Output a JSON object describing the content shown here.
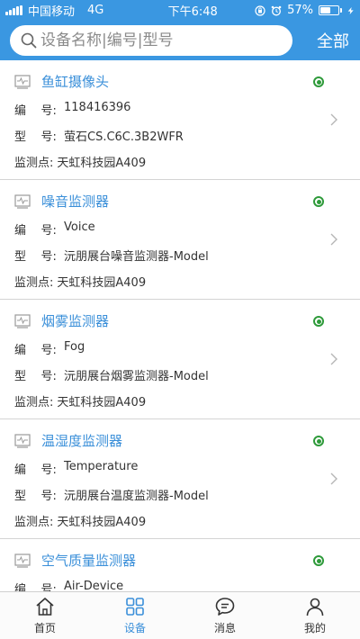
{
  "status_bar": {
    "carrier": "中国移动",
    "network": "4G",
    "time": "下午6:48",
    "battery": "57%",
    "battery_level": 0.57
  },
  "search": {
    "placeholder": "设备名称|编号|型号",
    "value": "",
    "filter_label": "全部"
  },
  "devices": [
    {
      "name": "鱼缸摄像头",
      "code_label": "编    号:",
      "code": "118416396",
      "model_label": "型    号:",
      "model": "萤石CS.C6C.3B2WFR",
      "location_label": "监测点:",
      "location": "天虹科技园A409",
      "status": "online",
      "status_color": "#2e9a3a"
    },
    {
      "name": "噪音监测器",
      "code_label": "编    号:",
      "code": "Voice",
      "model_label": "型    号:",
      "model": "沅朋展台噪音监测器-Model",
      "location_label": "监测点:",
      "location": "天虹科技园A409",
      "status": "online",
      "status_color": "#2e9a3a"
    },
    {
      "name": "烟雾监测器",
      "code_label": "编    号:",
      "code": "Fog",
      "model_label": "型    号:",
      "model": "沅朋展台烟雾监测器-Model",
      "location_label": "监测点:",
      "location": "天虹科技园A409",
      "status": "online",
      "status_color": "#2e9a3a"
    },
    {
      "name": "温湿度监测器",
      "code_label": "编    号:",
      "code": "Temperature",
      "model_label": "型    号:",
      "model": "沅朋展台温度监测器-Model",
      "location_label": "监测点:",
      "location": "天虹科技园A409",
      "status": "online",
      "status_color": "#2e9a3a"
    },
    {
      "name": "空气质量监测器",
      "code_label": "编    号:",
      "code": "Air-Device",
      "status": "online",
      "status_color": "#2e9a3a"
    }
  ],
  "tabbar": {
    "tabs": [
      {
        "label": "首页",
        "icon": "home-icon",
        "active": false
      },
      {
        "label": "设备",
        "icon": "grid-icon",
        "active": true
      },
      {
        "label": "消息",
        "icon": "chat-icon",
        "active": false
      },
      {
        "label": "我的",
        "icon": "person-icon",
        "active": false
      }
    ]
  },
  "colors": {
    "primary": "#3a97e1",
    "link": "#3a8fd9",
    "online": "#2e9a3a"
  }
}
